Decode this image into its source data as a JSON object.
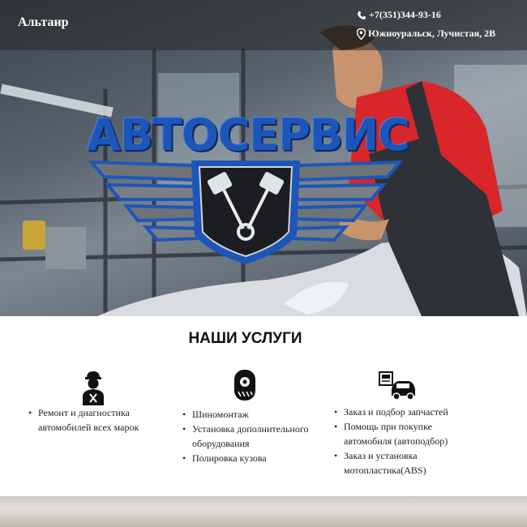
{
  "header": {
    "brand": "Альтаир",
    "phone": "+7(351)344-93-16",
    "address": "Южноуральск, Лучистая, 2В"
  },
  "hero": {
    "logo_text": "АВТОСЕРВИС",
    "logo_color": "#1d56b8"
  },
  "services": {
    "title": "НАШИ УСЛУГИ",
    "columns": [
      {
        "icon": "mechanic-icon",
        "items": [
          "Ремонт и диагностика автомобилей всех марок"
        ]
      },
      {
        "icon": "tire-icon",
        "items": [
          "Шиномонтаж",
          "Установка дополнительного оборудования",
          "Полировка кузова"
        ]
      },
      {
        "icon": "car-parts-icon",
        "items": [
          "Заказ и подбор запчастей",
          "Помощь при покупке автомобиля (автоподбор)",
          "Заказ и установка мотопластика(ABS)"
        ]
      }
    ]
  }
}
